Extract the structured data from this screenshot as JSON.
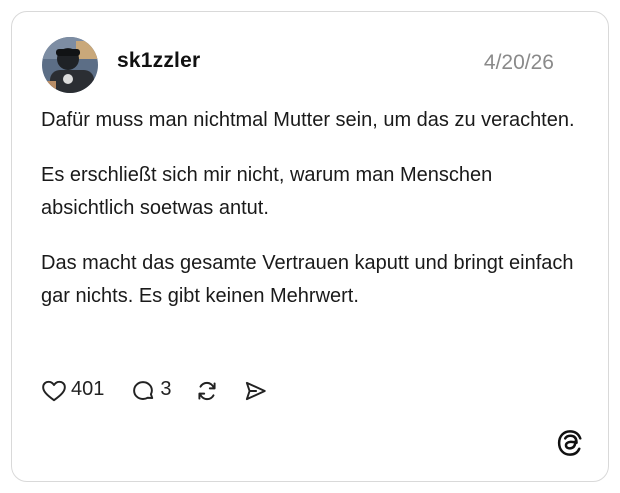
{
  "post": {
    "username": "sk1zzler",
    "date": "4/20/26",
    "paragraphs": [
      "Dafür muss man nichtmal Mutter sein, um das zu verachten.",
      "Es erschließt sich mir nicht, warum man Menschen absichtlich soetwas antut.",
      "Das macht das gesamte Vertrauen kaputt und bringt einfach gar nichts. Es gibt keinen Mehrwert."
    ]
  },
  "actions": {
    "like_count": "401",
    "reply_count": "3"
  },
  "icons": {
    "like": "heart-icon",
    "reply": "speech-bubble-icon",
    "repost": "repost-icon",
    "share": "send-icon",
    "brand": "threads-logo-icon"
  },
  "colors": {
    "text": "#1a1a1a",
    "muted": "#8a8a8a",
    "border": "#d9d9d9"
  }
}
